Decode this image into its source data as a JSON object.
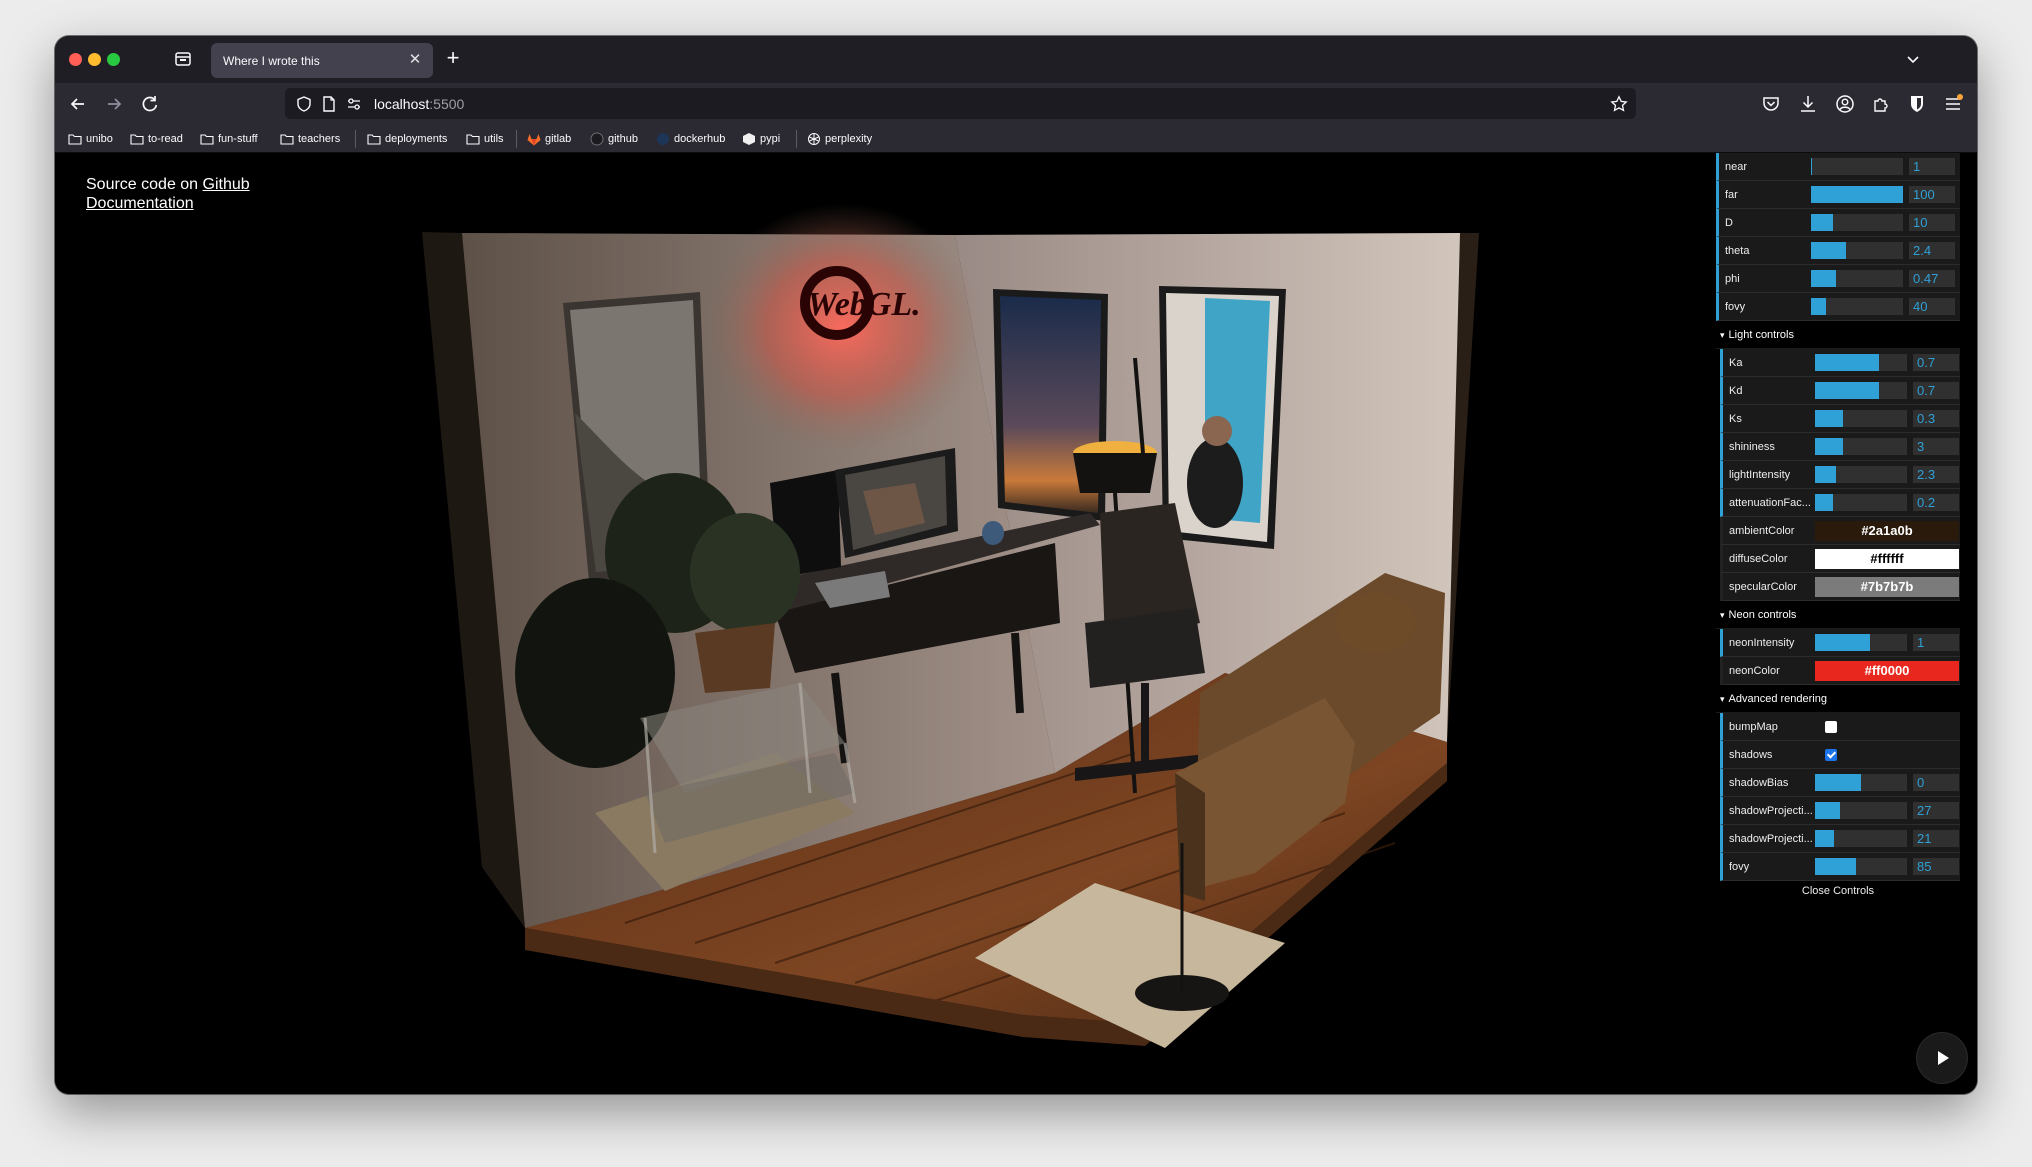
{
  "browser": {
    "tab_title": "Where I wrote this",
    "url_host": "localhost",
    "url_port": ":5500",
    "bookmarks": [
      {
        "label": "unibo",
        "icon": "folder-icon"
      },
      {
        "label": "to-read",
        "icon": "folder-icon"
      },
      {
        "label": "fun-stuff",
        "icon": "folder-icon"
      },
      {
        "label": "teachers",
        "icon": "folder-icon"
      },
      {
        "label": "deployments",
        "icon": "folder-icon"
      },
      {
        "label": "utils",
        "icon": "folder-icon"
      },
      {
        "label": "gitlab",
        "icon": "gitlab-icon"
      },
      {
        "label": "github",
        "icon": "github-icon"
      },
      {
        "label": "dockerhub",
        "icon": "docker-icon"
      },
      {
        "label": "pypi",
        "icon": "pypi-icon"
      },
      {
        "label": "perplexity",
        "icon": "perplexity-icon"
      }
    ]
  },
  "page": {
    "source_prefix": "Source code on ",
    "github_link": "Github",
    "docs_link": "Documentation",
    "scene_logo": "WebGL."
  },
  "gui": {
    "camera": [
      {
        "name": "near",
        "value": "1",
        "fraction": 0.01
      },
      {
        "name": "far",
        "value": "100",
        "fraction": 1.0
      },
      {
        "name": "D",
        "value": "10",
        "fraction": 0.24
      },
      {
        "name": "theta",
        "value": "2.4",
        "fraction": 0.38
      },
      {
        "name": "phi",
        "value": "0.47",
        "fraction": 0.27
      },
      {
        "name": "fovy",
        "value": "40",
        "fraction": 0.16
      }
    ],
    "light_title": "Light controls",
    "light": [
      {
        "name": "Ka",
        "value": "0.7",
        "fraction": 0.7
      },
      {
        "name": "Kd",
        "value": "0.7",
        "fraction": 0.7
      },
      {
        "name": "Ks",
        "value": "0.3",
        "fraction": 0.3
      },
      {
        "name": "shininess",
        "value": "3",
        "fraction": 0.3
      },
      {
        "name": "lightIntensity",
        "value": "2.3",
        "fraction": 0.23
      },
      {
        "name": "attenuationFac...",
        "value": "0.2",
        "fraction": 0.2
      }
    ],
    "light_colors": [
      {
        "name": "ambientColor",
        "value": "#2a1a0b",
        "bg": "#2a1a0b",
        "fg": "#ffffff"
      },
      {
        "name": "diffuseColor",
        "value": "#ffffff",
        "bg": "#ffffff",
        "fg": "#000000"
      },
      {
        "name": "specularColor",
        "value": "#7b7b7b",
        "bg": "#7b7b7b",
        "fg": "#ffffff"
      }
    ],
    "neon_title": "Neon controls",
    "neon_intensity": {
      "name": "neonIntensity",
      "value": "1",
      "fraction": 0.6
    },
    "neon_color": {
      "name": "neonColor",
      "value": "#ff0000",
      "bg": "#e8281e",
      "fg": "#ffffff"
    },
    "advanced_title": "Advanced rendering",
    "bumpmap": {
      "name": "bumpMap",
      "checked": false
    },
    "shadows": {
      "name": "shadows",
      "checked": true
    },
    "advanced": [
      {
        "name": "shadowBias",
        "value": "0",
        "fraction": 0.5
      },
      {
        "name": "shadowProjecti...",
        "value": "27",
        "fraction": 0.27
      },
      {
        "name": "shadowProjecti...",
        "value": "21",
        "fraction": 0.21
      },
      {
        "name": "fovy",
        "value": "85",
        "fraction": 0.45
      }
    ],
    "close_label": "Close Controls"
  },
  "colors": {
    "accent": "#2fa1d6",
    "neon": "#ff0000"
  }
}
